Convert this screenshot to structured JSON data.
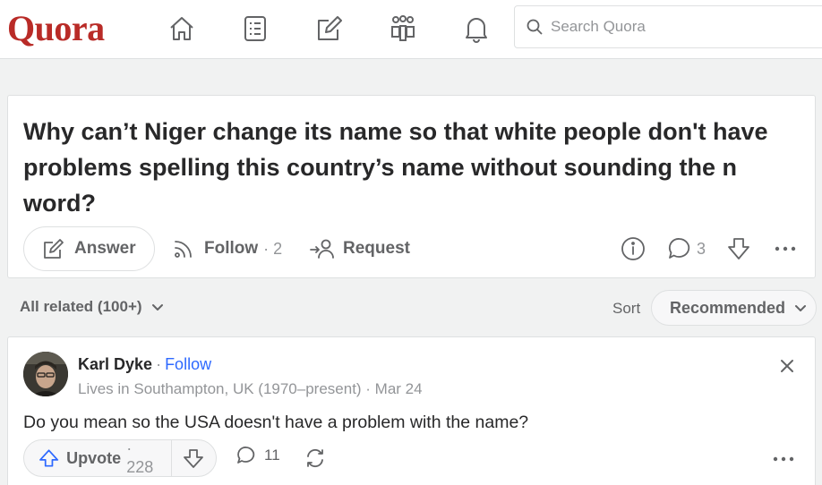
{
  "brand": {
    "logo": "Quora",
    "color": "#b92b27"
  },
  "nav": {
    "icons": [
      "home-icon",
      "following-icon",
      "answer-icon",
      "spaces-icon",
      "notifications-icon"
    ]
  },
  "search": {
    "placeholder": "Search Quora"
  },
  "question": {
    "title": "Why can’t Niger change its name so that white people don't have problems spelling this country’s name without sounding the n word?",
    "answer_label": "Answer",
    "follow_label": "Follow",
    "follow_count": "· 2",
    "request_label": "Request",
    "comment_count": "3"
  },
  "related": {
    "label": "All related (100+)",
    "sort_label": "Sort",
    "sort_value": "Recommended"
  },
  "answer": {
    "author": "Karl Dyke",
    "separator": "·",
    "follow_label": "Follow",
    "credential": "Lives in Southampton, UK (1970–present) · Mar 24",
    "text": "Do you mean so the USA doesn't have a problem with the name?",
    "upvote_label": "Upvote",
    "upvote_count": "· 228",
    "comment_count": "11"
  },
  "colors": {
    "accent": "#2e69ff",
    "text": "#282829",
    "muted": "#636466",
    "light": "#939598"
  }
}
